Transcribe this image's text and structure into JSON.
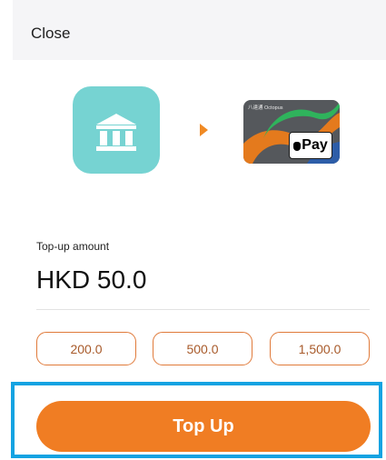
{
  "header": {
    "close_label": "Close"
  },
  "source": {
    "icon": "bank-icon",
    "color": "#76d3d2"
  },
  "direction": {
    "icon": "arrow-right-icon",
    "color": "#f08a24"
  },
  "destination": {
    "icon": "octopus-card-icon",
    "brand_text": "八達通 Octopus",
    "wallet_badge": "Pay"
  },
  "topup": {
    "amount_label": "Top-up amount",
    "amount_value": "HKD 50.0",
    "presets": [
      "200.0",
      "500.0",
      "1,500.0"
    ],
    "submit_label": "Top Up",
    "accent_color": "#f07d23",
    "highlight_color": "#14a3e2"
  }
}
